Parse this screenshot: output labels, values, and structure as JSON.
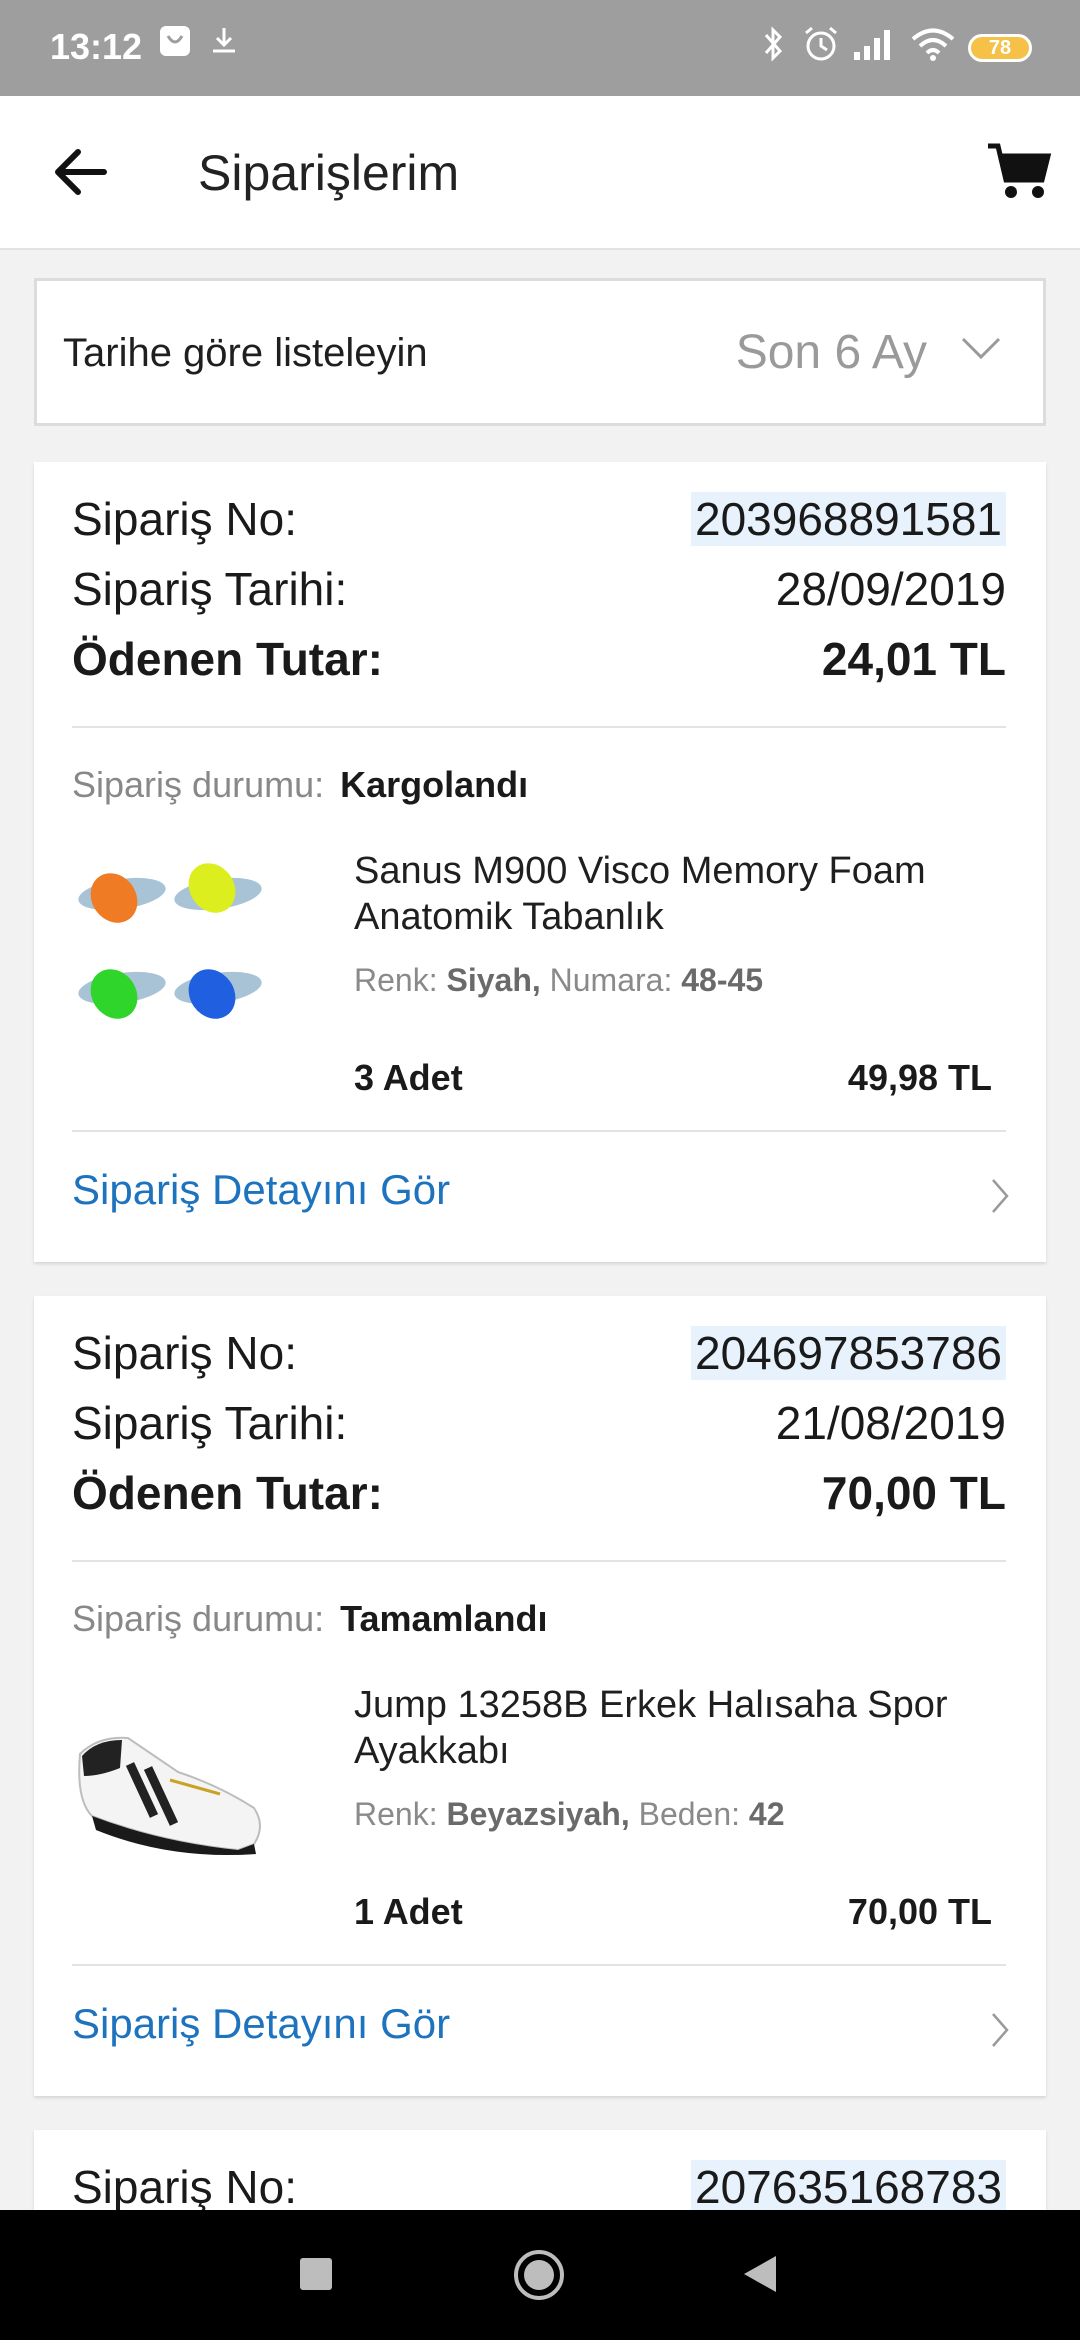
{
  "status_bar": {
    "time": "13:12",
    "battery": "78"
  },
  "app_bar": {
    "title": "Siparişlerim"
  },
  "filter": {
    "label": "Tarihe göre listeleyin",
    "value": "Son 6 Ay"
  },
  "labels": {
    "order_no": "Sipariş No:",
    "order_date": "Sipariş Tarihi:",
    "paid_amount": "Ödenen Tutar:",
    "status": "Sipariş durumu:",
    "detail_link": "Sipariş Detayını Gör"
  },
  "orders": [
    {
      "order_no": "203968891581",
      "date": "28/09/2019",
      "total": "24,01 TL",
      "status": "Kargolandı",
      "product": {
        "name": "Sanus M900  Visco Memory Foam Anatomik Tabanlık",
        "attr1_label": "Renk:",
        "attr1_value": "Siyah,",
        "attr2_label": "Numara:",
        "attr2_value": "48-45",
        "quantity": "3 Adet",
        "price": "49,98 TL",
        "image": "insole-image"
      }
    },
    {
      "order_no": "204697853786",
      "date": "21/08/2019",
      "total": "70,00 TL",
      "status": "Tamamlandı",
      "product": {
        "name": "Jump 13258B Erkek Halısaha Spor Ayakkabı",
        "attr1_label": "Renk:",
        "attr1_value": "Beyazsiyah,",
        "attr2_label": "Beden:",
        "attr2_value": "42",
        "quantity": "1 Adet",
        "price": "70,00 TL",
        "image": "shoe-image"
      }
    },
    {
      "order_no": "207635168783"
    }
  ],
  "colors": {
    "status_bar": "#9e9e9e",
    "link": "#1e73be",
    "order_no_highlight": "#e7f2fc",
    "nav_bar": "#000000"
  },
  "icons": {
    "back": "arrow-left-icon",
    "cart": "cart-icon",
    "chevron": "chevron-down-icon",
    "detail": "chevron-right-icon",
    "nav": [
      "recents-icon",
      "home-icon",
      "back-triangle-icon"
    ]
  }
}
